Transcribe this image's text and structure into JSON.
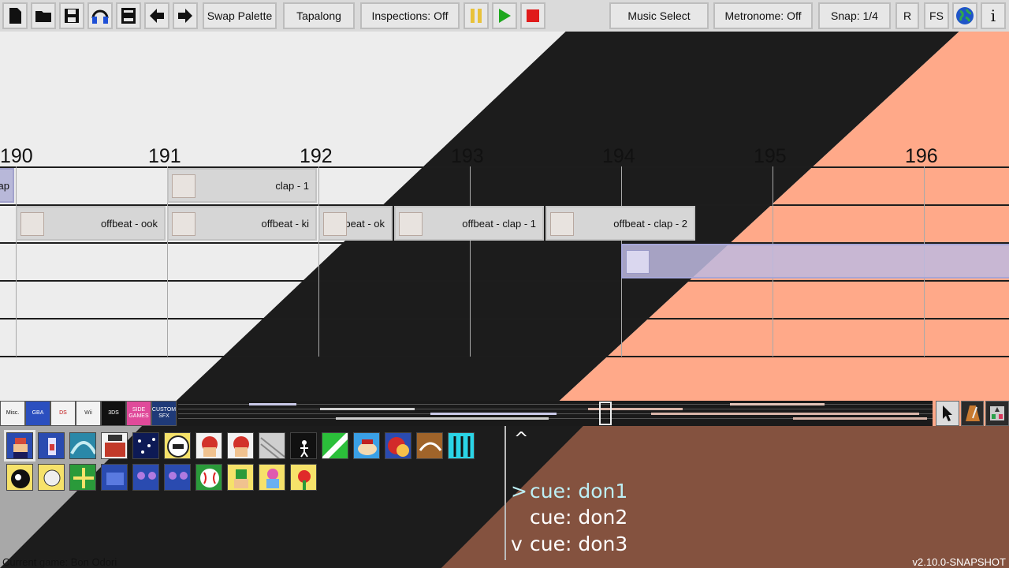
{
  "toolbar": {
    "icons_left": [
      "new-file-icon",
      "open-folder-icon",
      "save-icon",
      "headphones-icon",
      "export-icon",
      "undo-arrow-icon",
      "redo-arrow-icon"
    ],
    "swap_palette": "Swap Palette",
    "tapalong": "Tapalong",
    "inspections": "Inspections: Off",
    "music_select": "Music Select",
    "metronome": "Metronome: Off",
    "snap": "Snap: 1/4",
    "r": "R",
    "fs": "FS",
    "info": "i",
    "colors": {
      "pause": "#e8c23a",
      "play": "#1ea81e",
      "stop": "#e01b1b"
    }
  },
  "ruler": {
    "beats": [
      "190",
      "191",
      "192",
      "193",
      "194",
      "195",
      "196"
    ]
  },
  "tracks": {
    "row1": [
      {
        "label": "ap"
      },
      {
        "label": "clap - 1"
      }
    ],
    "row2": [
      {
        "label": "offbeat - ook"
      },
      {
        "label": "offbeat - ki"
      },
      {
        "label": "offbeat - ok"
      },
      {
        "label": "offbeat - clap - 1"
      },
      {
        "label": "offbeat - clap - 2"
      }
    ],
    "row3": [
      {
        "label": ""
      }
    ]
  },
  "game_categories": [
    "Misc.",
    "GBA",
    "DS",
    "Wii",
    "3DS",
    "SIDE GAMES",
    "CUSTOM SFX"
  ],
  "cues": {
    "up_arrow": "^",
    "down_arrow": "v",
    "selected_marker": ">",
    "items": [
      "cue: don1",
      "cue: don2",
      "cue: don3"
    ]
  },
  "status": {
    "current_game": "Current game: Bon Odori",
    "version": "v2.10.0-SNAPSHOT"
  },
  "theme": {
    "left_band": "#ededed",
    "middle_band": "#1c1c1c",
    "right_band": "#ffa989",
    "right_band_dark": "#84523f"
  }
}
